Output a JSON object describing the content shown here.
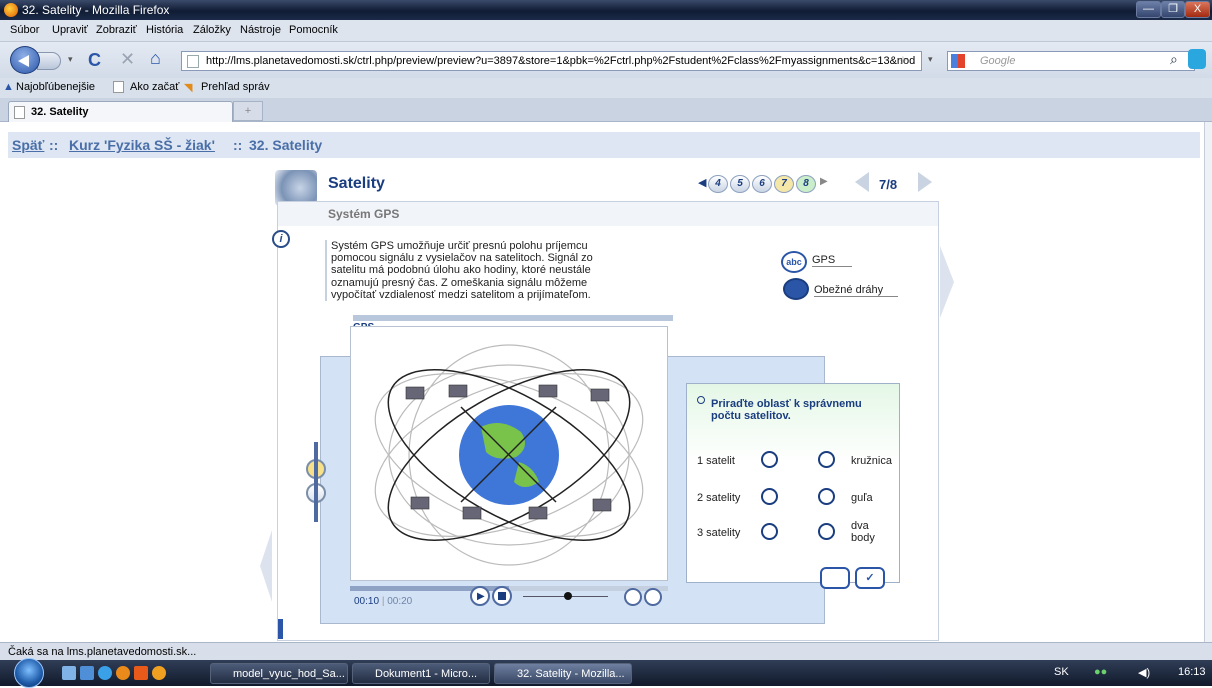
{
  "window": {
    "title": "32. Satelity - Mozilla Firefox",
    "controls": [
      "—",
      "❐",
      "X"
    ]
  },
  "menu": [
    "Súbor",
    "Upraviť",
    "Zobraziť",
    "História",
    "Záložky",
    "Nástroje",
    "Pomocník"
  ],
  "navbar": {
    "url": "http://lms.planetavedomosti.sk/ctrl.php/preview/preview?u=3897&store=1&pbk=%2Fctrl.php%2Fstudent%2Fclass%2Fmyassignments&c=13&nod",
    "search_placeholder": "Google"
  },
  "bookmarks": [
    "Najobľúbenejšie",
    "Ako začať",
    "Prehľad správ"
  ],
  "tabs": [
    {
      "label": "32. Satelity"
    }
  ],
  "breadcrumb": {
    "back": "Späť",
    "sep1": "::",
    "course": "Kurz 'Fyzika SŠ - žiak'",
    "sep2": "::",
    "current": "32. Satelity"
  },
  "lesson": {
    "title": "Satelity",
    "subtitle": "Systém GPS",
    "description": "Systém GPS umožňuje určiť presnú polohu príjemcu pomocou signálu z vysielačov na satelitoch. Signál zo satelitu má podobnú úlohu ako hodiny, ktoré neustále oznamujú presný čas. Z omeškania signálu môžeme vypočítať vzdialenosť medzi satelitom a prijímateľom.",
    "glossary_links": [
      {
        "label": "GPS",
        "icon": "abc-icon"
      },
      {
        "label": "Obežné dráhy",
        "icon": "book-icon"
      }
    ],
    "pager": {
      "pages": [
        "4",
        "5",
        "6",
        "7",
        "8"
      ],
      "current_text": "7/8",
      "colors": {
        "page7": "#f4e7a8",
        "page8": "#c9eec9"
      }
    },
    "video": {
      "label": "GPS",
      "time_current": "00:10",
      "time_sep": "|",
      "time_total": "00:20",
      "progress": 0.5
    },
    "quiz": {
      "prompt": "Priraďte oblasť k správnemu počtu satelitov.",
      "rows": [
        {
          "left": "1 satelit",
          "right": "kružnica"
        },
        {
          "left": "2 satelity",
          "right": "guľa"
        },
        {
          "left": "3 satelity",
          "right": "dva body"
        }
      ]
    }
  },
  "status": "Čaká sa na lms.planetavedomosti.sk...",
  "taskbar": {
    "items": [
      {
        "label": "model_vyuc_hod_Sa..."
      },
      {
        "label": "Dokument1 - Micro..."
      },
      {
        "label": "32. Satelity - Mozilla..."
      }
    ],
    "lang": "SK",
    "time": "16:13"
  },
  "colors": {
    "accent": "#1a3d80",
    "crumb_link": "#4a6fa8"
  }
}
